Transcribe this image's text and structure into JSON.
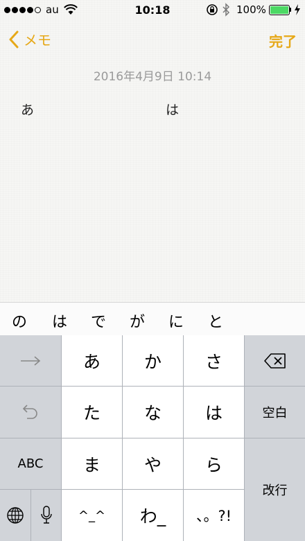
{
  "status": {
    "carrier": "au",
    "time": "10:18",
    "battery": "100%",
    "battery_level": 1.0,
    "colors": {
      "battery_fill": "#4cd964"
    }
  },
  "nav": {
    "back_label": "メモ",
    "done_label": "完了",
    "accent_color": "#e6a817"
  },
  "note": {
    "date": "2016年4月9日 10:14",
    "body": "あ　　　　　　　　　　は"
  },
  "candidates": [
    "の",
    "は",
    "で",
    "が",
    "に",
    "と"
  ],
  "keyboard": {
    "left": {
      "next_icon": "arrow-right-icon",
      "undo_icon": "undo-icon",
      "abc": "ABC",
      "globe_icon": "globe-icon",
      "mic_icon": "mic-icon"
    },
    "rows": [
      [
        "あ",
        "か",
        "さ"
      ],
      [
        "た",
        "な",
        "は"
      ],
      [
        "ま",
        "や",
        "ら"
      ],
      [
        "^_^",
        "わ_",
        "、。?!"
      ]
    ],
    "right": {
      "delete_icon": "delete-icon",
      "space": "空白",
      "enter": "改行"
    }
  }
}
